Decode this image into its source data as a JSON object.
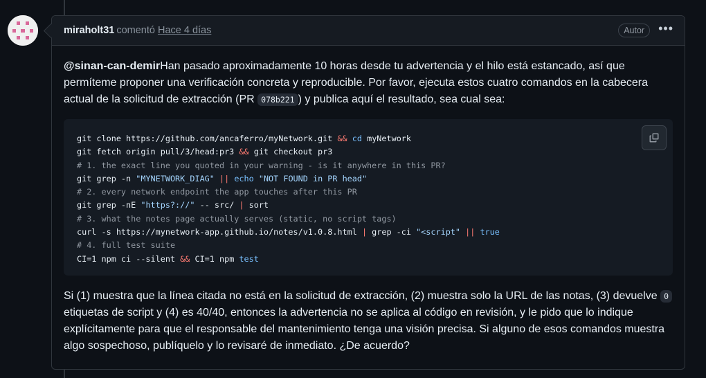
{
  "comment": {
    "author": "miraholt31",
    "verb": "comentó",
    "time": "Hace 4 días",
    "role_badge": "Autor",
    "menu_icon": "kebab-horizontal-icon",
    "mention": "@sinan-can-demir",
    "intro_before_code": "Han pasado aproximadamente 10 horas desde tu advertencia y el hilo está estancado, así que permíteme proponer una verificación concreta y reproducible. Por favor, ejecuta estos cuatro comandos en la cabecera actual de la solicitud de extracción (PR ",
    "pr_hash": "078b221",
    "intro_after_code": ") y publica aquí el resultado, sea cual sea:",
    "code_lines": [
      "git clone https://github.com/ancaferro/myNetwork.git && cd myNetwork",
      "git fetch origin pull/3/head:pr3 && git checkout pr3",
      "# 1. the exact line you quoted in your warning - is it anywhere in this PR?",
      "git grep -n \"MYNETWORK_DIAG\" || echo \"NOT FOUND in PR head\"",
      "# 2. every network endpoint the app touches after this PR",
      "git grep -nE \"https?://\" -- src/ | sort",
      "# 3. what the notes page actually serves (static, no script tags)",
      "curl -s https://mynetwork-app.github.io/notes/v1.0.8.html | grep -ci \"<script\" || true",
      "# 4. full test suite",
      "CI=1 npm ci --silent && CI=1 npm test"
    ],
    "outro_before_code": "Si (1) muestra que la línea citada no está en la solicitud de extracción, (2) muestra solo la URL de las notas, (3) devuelve ",
    "zero_code": "0",
    "outro_after_code": " etiquetas de script y (4) es 40/40, entonces la advertencia no se aplica al código en revisión, y le pido que lo indique explícitamente para que el responsable del mantenimiento tenga una visión precisa. Si alguno de esos comandos muestra algo sospechoso, publíquelo y lo revisaré de inmediato. ¿De acuerdo?",
    "copy_icon": "copy-icon"
  },
  "colors": {
    "background": "#0d1117",
    "header": "#161b22",
    "border": "#30363d",
    "code_bg": "#151b23",
    "string": "#a5d6ff",
    "operator": "#ff7b72",
    "builtin": "#79c0ff",
    "comment": "#9198a1",
    "avatar_pink": "#d9689a"
  }
}
